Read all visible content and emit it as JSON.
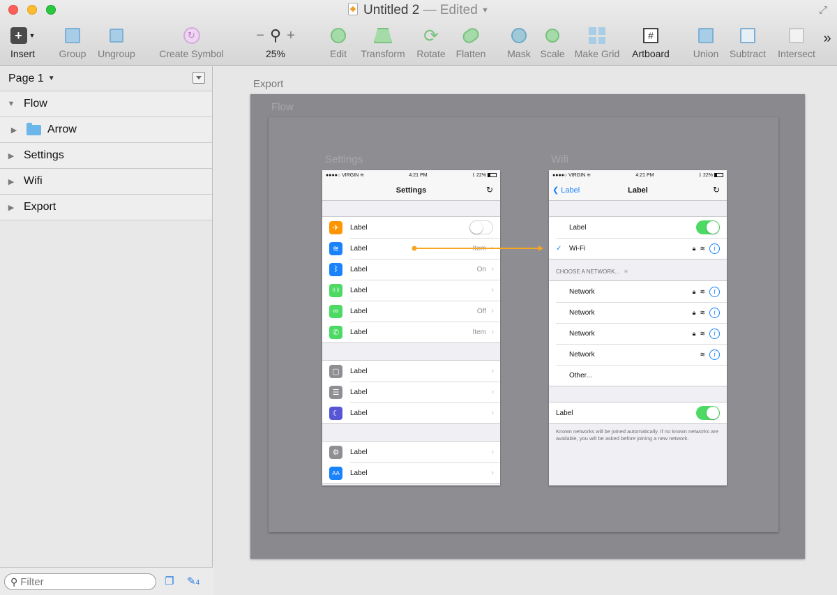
{
  "window": {
    "title": "Untitled 2",
    "status": "— Edited"
  },
  "toolbar": {
    "insert": "Insert",
    "group": "Group",
    "ungroup": "Ungroup",
    "create_symbol": "Create Symbol",
    "zoom_minus": "−",
    "zoom_plus": "+",
    "zoom_level": "25%",
    "edit": "Edit",
    "transform": "Transform",
    "rotate": "Rotate",
    "flatten": "Flatten",
    "mask": "Mask",
    "scale": "Scale",
    "make_grid": "Make Grid",
    "artboard": "Artboard",
    "union": "Union",
    "subtract": "Subtract",
    "intersect": "Intersect",
    "more": "»"
  },
  "sidebar": {
    "page": "Page 1",
    "layers": [
      {
        "name": "Flow",
        "expanded": true
      },
      {
        "name": "Arrow",
        "folder": true
      },
      {
        "name": "Settings"
      },
      {
        "name": "Wifi"
      },
      {
        "name": "Export"
      }
    ],
    "filter_placeholder": "Filter",
    "edit_count": "4"
  },
  "canvas": {
    "export_label": "Export",
    "flow_label": "Flow",
    "settings_label": "Settings",
    "wifi_label": "Wifi"
  },
  "status_bar": {
    "carrier": "●●●●○ VIRGIN",
    "time": "4:21 PM",
    "battery": "22%"
  },
  "settings_screen": {
    "title": "Settings",
    "groups": [
      [
        {
          "label": "Label",
          "value": "",
          "icon": "airplane-icon",
          "color": "#ff9500",
          "toggle": "off"
        },
        {
          "label": "Label",
          "value": "Item",
          "icon": "wifi-icon",
          "color": "#1a82fb"
        },
        {
          "label": "Label",
          "value": "On",
          "icon": "bluetooth-icon",
          "color": "#1a82fb"
        },
        {
          "label": "Label",
          "value": "",
          "icon": "cellular-icon",
          "color": "#4cd964"
        },
        {
          "label": "Label",
          "value": "Off",
          "icon": "hotspot-icon",
          "color": "#4cd964"
        },
        {
          "label": "Label",
          "value": "Item",
          "icon": "phone-icon",
          "color": "#4cd964"
        }
      ],
      [
        {
          "label": "Label",
          "value": "",
          "icon": "notifications-icon",
          "color": "#8e8e93"
        },
        {
          "label": "Label",
          "value": "",
          "icon": "control-center-icon",
          "color": "#8e8e93"
        },
        {
          "label": "Label",
          "value": "",
          "icon": "moon-icon",
          "color": "#5856d6"
        }
      ],
      [
        {
          "label": "Label",
          "value": "",
          "icon": "gear-icon",
          "color": "#8e8e93"
        },
        {
          "label": "Label",
          "value": "",
          "icon": "text-size-icon",
          "color": "#1a82fb"
        }
      ]
    ]
  },
  "wifi_screen": {
    "back": "Label",
    "title": "Label",
    "toggle_label": "Label",
    "wifi_label": "Wi-Fi",
    "section": "CHOOSE A NETWORK...",
    "networks": [
      "Network",
      "Network",
      "Network",
      "Network"
    ],
    "other": "Other...",
    "ask_label": "Label",
    "footnote": "Known networks will be joined automatically. If no known networks are available, you will be asked before joining a new network."
  },
  "colors": {
    "accent": "#1a82fb",
    "toggle_on": "#4cd964",
    "flow_arrow": "#f5a623"
  }
}
